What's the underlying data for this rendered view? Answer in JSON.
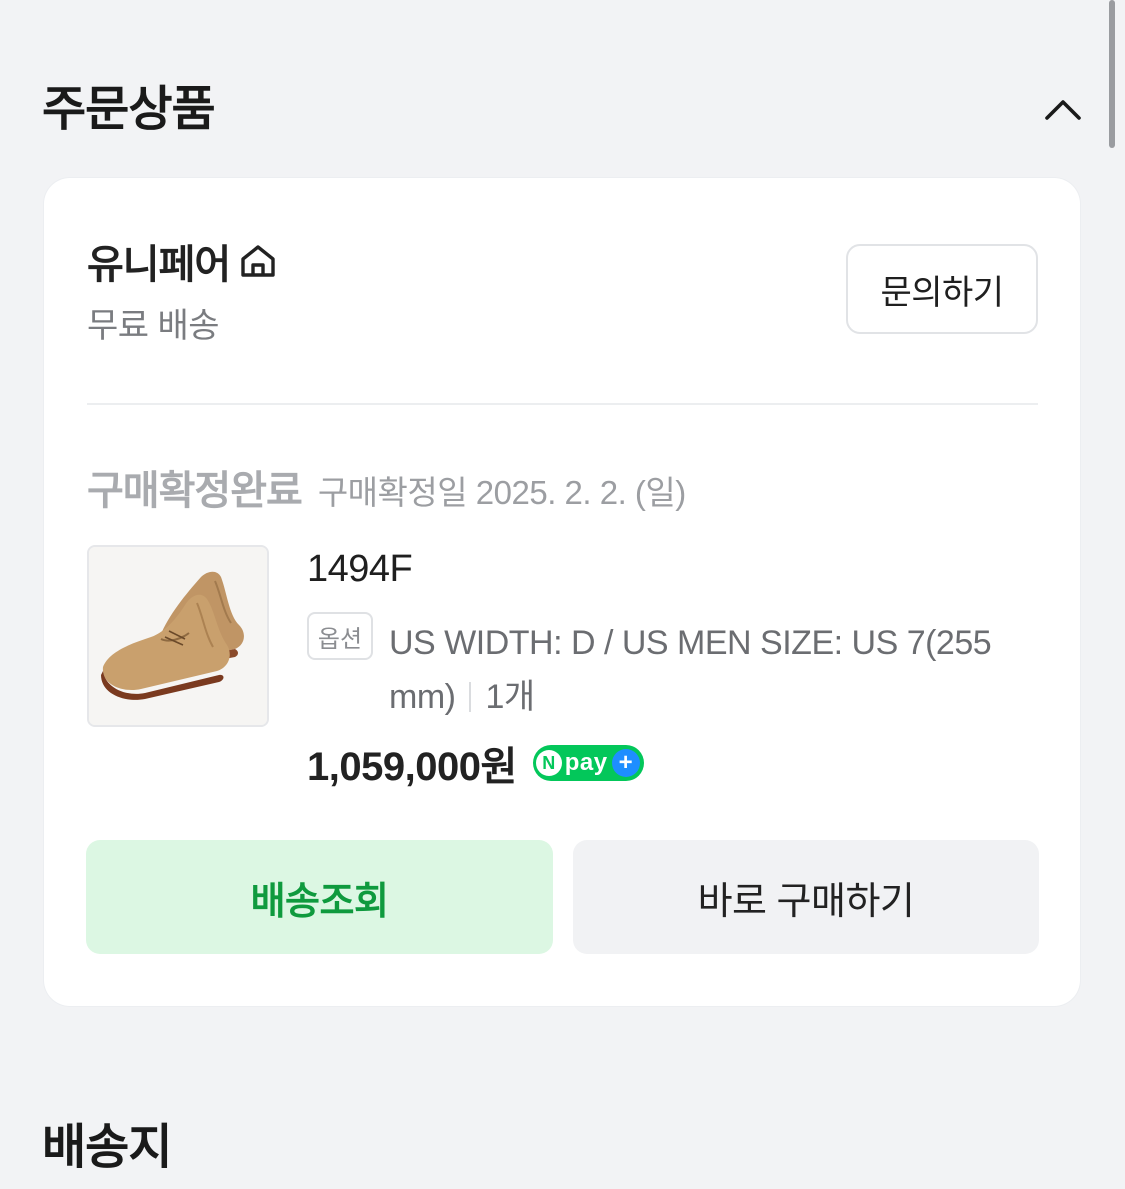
{
  "order_section": {
    "title": "주문상품"
  },
  "seller": {
    "name": "유니페어",
    "shipping": "무료 배송",
    "inquiry_label": "문의하기"
  },
  "order": {
    "status": "구매확정완료",
    "confirm_date": "구매확정일 2025. 2. 2. (일)"
  },
  "product": {
    "name": "1494F",
    "option_tag": "옵션",
    "option_text": "US WIDTH: D / US MEN SIZE: US 7(255 mm)",
    "quantity": "1개",
    "price": "1,059,000원"
  },
  "npay": {
    "n": "N",
    "text": "pay",
    "plus": "+"
  },
  "actions": {
    "track_label": "배송조회",
    "buy_again_label": "바로 구매하기"
  },
  "delivery_section": {
    "title": "배송지"
  },
  "colors": {
    "background": "#f2f3f5",
    "card": "#ffffff",
    "npay_green": "#03c75a",
    "track_green_text": "#0f9a3e",
    "track_green_bg": "#dcf7e3"
  }
}
